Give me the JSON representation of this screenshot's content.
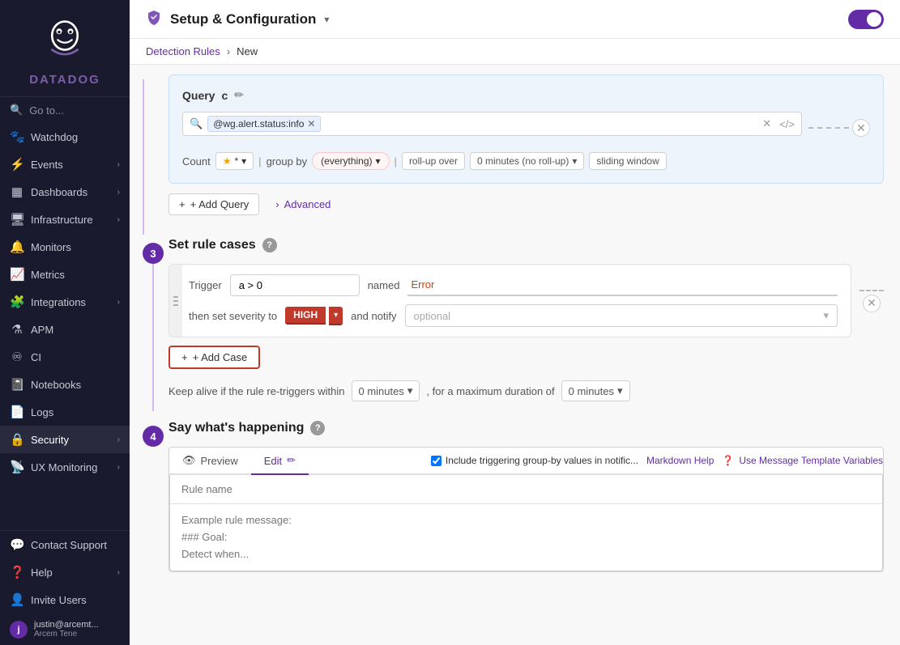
{
  "app": {
    "logo_text": "DATADOG"
  },
  "header": {
    "shield_label": "⚙",
    "title": "Setup & Configuration",
    "toggle_on": true
  },
  "breadcrumb": {
    "parent": "Detection Rules",
    "separator": "›",
    "current": "New"
  },
  "sidebar": {
    "search": "Go to...",
    "items": [
      {
        "id": "watchdog",
        "icon": "🐾",
        "label": "Watchdog",
        "has_chevron": false
      },
      {
        "id": "events",
        "icon": "⚡",
        "label": "Events",
        "has_chevron": true
      },
      {
        "id": "dashboards",
        "icon": "📊",
        "label": "Dashboards",
        "has_chevron": true
      },
      {
        "id": "infrastructure",
        "icon": "🖥",
        "label": "Infrastructure",
        "has_chevron": true
      },
      {
        "id": "monitors",
        "icon": "🔔",
        "label": "Monitors",
        "has_chevron": false
      },
      {
        "id": "metrics",
        "icon": "📈",
        "label": "Metrics",
        "has_chevron": false
      },
      {
        "id": "integrations",
        "icon": "🔗",
        "label": "Integrations",
        "has_chevron": true
      },
      {
        "id": "apm",
        "icon": "⚗",
        "label": "APM",
        "has_chevron": false
      },
      {
        "id": "ci",
        "icon": "♾",
        "label": "CI",
        "has_chevron": false
      },
      {
        "id": "notebooks",
        "icon": "📓",
        "label": "Notebooks",
        "has_chevron": false
      },
      {
        "id": "logs",
        "icon": "📄",
        "label": "Logs",
        "has_chevron": false
      },
      {
        "id": "security",
        "icon": "🔒",
        "label": "Security",
        "has_chevron": true,
        "active": true
      },
      {
        "id": "ux_monitoring",
        "icon": "📡",
        "label": "UX Monitoring",
        "has_chevron": true
      }
    ],
    "bottom_items": [
      {
        "id": "contact_support",
        "icon": "💬",
        "label": "Contact Support"
      },
      {
        "id": "help",
        "icon": "❓",
        "label": "Help",
        "has_chevron": true
      },
      {
        "id": "invite_users",
        "icon": "👤",
        "label": "Invite Users"
      }
    ],
    "user": {
      "avatar": "j",
      "name": "justin@arcemt...",
      "subtitle": "Arcem Tene"
    }
  },
  "query_section": {
    "label": "Query",
    "id": "c",
    "filter_value": "@wg.alert.status:info",
    "count_label": "Count",
    "star": "*",
    "group_by_label": "group by",
    "group_by_value": "(everything)",
    "rollup_label": "roll-up over",
    "rollup_value": "0 minutes (no roll-up)",
    "window_label": "sliding window",
    "add_query_label": "+ Add Query",
    "advanced_label": "Advanced"
  },
  "rule_cases": {
    "step_number": "3",
    "title": "Set rule cases",
    "trigger_label": "Trigger",
    "trigger_value": "a > 0",
    "named_label": "named",
    "name_value": "Error",
    "then_label": "then set severity to",
    "severity": "HIGH",
    "notify_label": "and notify",
    "notify_placeholder": "optional",
    "add_case_label": "+ Add Case",
    "keep_alive_label": "Keep alive if the rule re-triggers within",
    "keep_alive_value": "0 minutes",
    "max_duration_label": ", for a maximum duration of",
    "max_duration_value": "0 minutes"
  },
  "say_section": {
    "step_number": "4",
    "title": "Say what's happening",
    "tabs": [
      {
        "id": "preview",
        "label": "Preview",
        "icon": "👁",
        "active": false
      },
      {
        "id": "edit",
        "label": "Edit",
        "icon": "✏",
        "active": true
      }
    ],
    "include_label": "Include triggering group-by values in notific...",
    "markdown_label": "Markdown Help",
    "template_vars_label": "Use Message Template Variables",
    "rule_name_placeholder": "Rule name",
    "message_line1": "Example rule message:",
    "message_line2": "### Goal:",
    "message_line3": "Detect when..."
  }
}
